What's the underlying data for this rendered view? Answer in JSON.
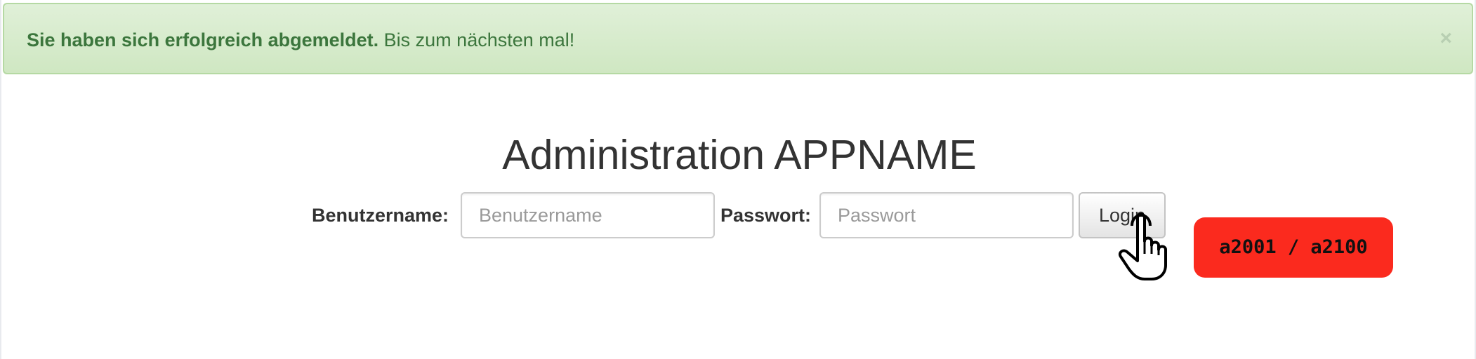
{
  "alert": {
    "strong_text": "Sie haben sich erfolgreich abgemeldet.",
    "text": " Bis zum nächsten mal!",
    "close_symbol": "×",
    "background_color": "#dff0d8",
    "text_color": "#3c763d"
  },
  "page": {
    "title": "Administration APPNAME"
  },
  "login_form": {
    "username_label": "Benutzername:",
    "username_placeholder": "Benutzername",
    "username_value": "",
    "password_label": "Passwort:",
    "password_placeholder": "Passwort",
    "password_value": "",
    "login_button_label": "Login"
  },
  "cursor": {
    "icon": "hand-pointer-icon"
  },
  "badge": {
    "text": "a2001 / a2100",
    "background_color": "#fb2a1e"
  }
}
